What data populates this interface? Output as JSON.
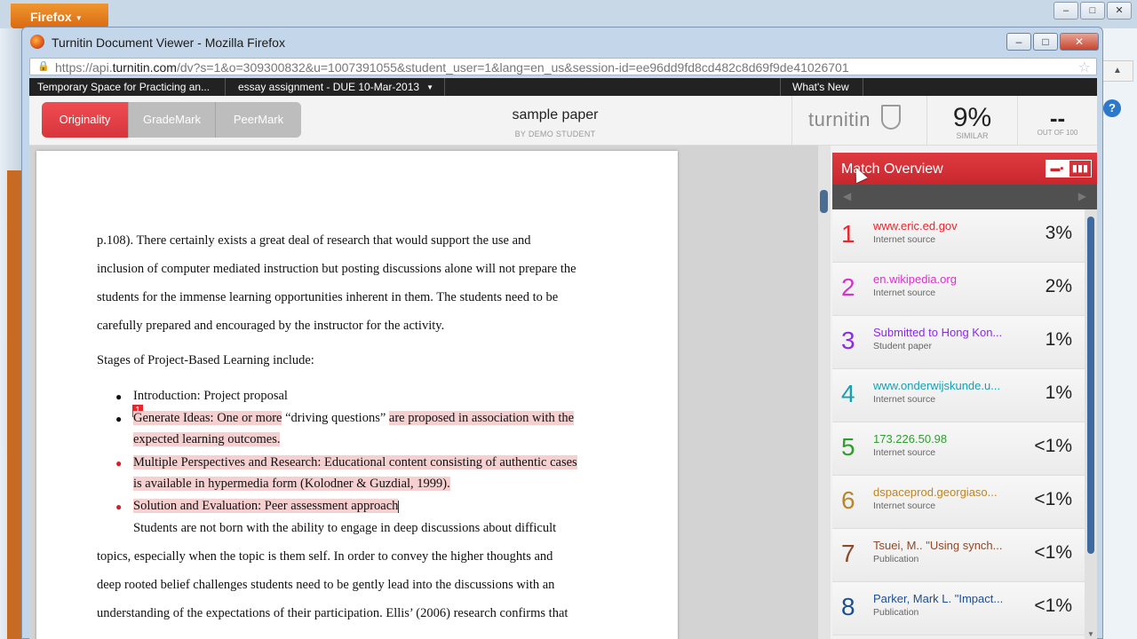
{
  "background_window": {
    "firefox_button_label": "Firefox",
    "controls": [
      "–",
      "□",
      "✕"
    ],
    "help_icon": "?"
  },
  "window": {
    "title": "Turnitin Document Viewer - Mozilla Firefox",
    "controls": [
      "–",
      "□",
      "✕"
    ],
    "url_prefix": "https://api.",
    "url_domain": "turnitin.com",
    "url_rest": "/dv?s=1&o=309300832&u=1007391055&student_user=1&lang=en_us&session-id=ee96dd9fd8cd482c8d69f9de41026701"
  },
  "topnav": {
    "class_name": "Temporary Space for Practicing an...",
    "assignment": "essay assignment - DUE 10-Mar-2013",
    "whats_new": "What's New"
  },
  "tabs": [
    "Originality",
    "GradeMark",
    "PeerMark"
  ],
  "paper": {
    "title": "sample paper",
    "author": "BY DEMO STUDENT"
  },
  "brand": "turnitin",
  "similarity": {
    "value": "9%",
    "label": "SIMILAR"
  },
  "grade": {
    "value": "--",
    "label": "OUT OF 100"
  },
  "document": {
    "lines": [
      "p.108).  There certainly exists a great deal of research that would support the use and",
      "inclusion of computer mediated instruction but posting discussions alone will not prepare the",
      "students for the immense learning opportunities inherent in them.  The students need to be",
      "carefully prepared and encouraged by the instructor for the activity.",
      "Stages of Project-Based Learning include:"
    ],
    "bullet1": "Introduction: Project proposal",
    "bullet2_a": "Generate Ideas: One or more",
    "bullet2_b": " “driving questions” ",
    "bullet2_c": "are proposed in association with the",
    "bullet2_d": "expected learning outcomes.",
    "bullet3_a": "Multiple Perspectives and Research: Educational content consisting of authentic cases",
    "bullet3_b": "is available in hypermedia form (Kolodner & Guzdial, 1999).",
    "bullet4": "Solution and Evaluation: Peer assessment approach",
    "after_lines": [
      "Students are not born with the ability to engage in deep discussions about difficult",
      "topics, especially when the topic is them self.  In order to convey the higher thoughts and",
      "deep rooted belief challenges students need to be gently lead into the discussions with an",
      "understanding of the expectations of their participation.  Ellis’ (2006) research confirms that"
    ],
    "match_marker": "1"
  },
  "match_overview": {
    "title": "Match Overview",
    "matches": [
      {
        "num": "1",
        "source": "www.eric.ed.gov",
        "type": "Internet source",
        "pct": "3%",
        "color": "#e8262d"
      },
      {
        "num": "2",
        "source": "en.wikipedia.org",
        "type": "Internet source",
        "pct": "2%",
        "color": "#d633c8"
      },
      {
        "num": "3",
        "source": "Submitted to Hong Kon...",
        "type": "Student paper",
        "pct": "1%",
        "color": "#8a2be2"
      },
      {
        "num": "4",
        "source": "www.onderwijskunde.u...",
        "type": "Internet source",
        "pct": "1%",
        "color": "#1a9fb0"
      },
      {
        "num": "5",
        "source": "173.226.50.98",
        "type": "Internet source",
        "pct": "<1%",
        "color": "#2e9e2e"
      },
      {
        "num": "6",
        "source": "dspaceprod.georgiaso...",
        "type": "Internet source",
        "pct": "<1%",
        "color": "#b8862b"
      },
      {
        "num": "7",
        "source": "Tsuei, M.. \"Using synch...",
        "type": "Publication",
        "pct": "<1%",
        "color": "#8b4a2b"
      },
      {
        "num": "8",
        "source": "Parker, Mark L. \"Impact...",
        "type": "Publication",
        "pct": "<1%",
        "color": "#1f4e8c"
      }
    ]
  }
}
